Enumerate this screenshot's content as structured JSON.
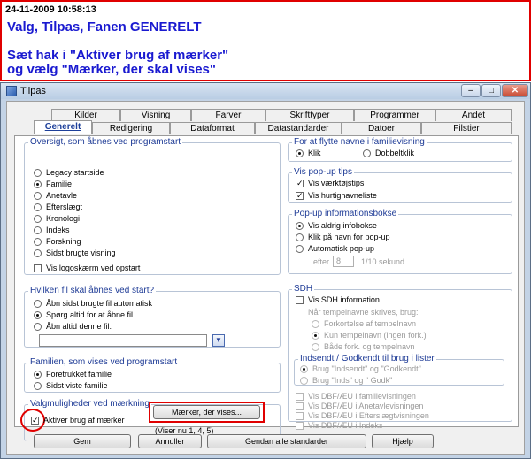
{
  "annotation": {
    "timestamp": "24-11-2009 10:58:13",
    "line1": "Valg, Tilpas, Fanen GENERELT",
    "line2": "Sæt hak i \"Aktiver brug af mærker\"",
    "line3": "og vælg \"Mærker, der skal vises\""
  },
  "window": {
    "title": "Tilpas",
    "btn_min": "–",
    "btn_max": "□",
    "btn_close": "✕"
  },
  "tabs_back": [
    "Kilder",
    "Visning",
    "Farver",
    "Skrifttyper",
    "Programmer",
    "Andet"
  ],
  "tabs_front": [
    "Generelt",
    "Redigering",
    "Dataformat",
    "Datastandarder",
    "Datoer",
    "Filstier"
  ],
  "startup": {
    "legend": "Oversigt, som åbnes ved programstart",
    "options": [
      "Legacy startside",
      "Familie",
      "Anetavle",
      "Efterslægt",
      "Kronologi",
      "Indeks",
      "Forskning",
      "Sidst brugte visning"
    ],
    "selected": "Familie",
    "logo_checkbox": "Vis logoskærm ved opstart"
  },
  "file_open": {
    "legend": "Hvilken fil skal åbnes ved start?",
    "options": [
      "Åbn sidst brugte fil automatisk",
      "Spørg altid for at åbne fil",
      "Åbn altid denne fil:"
    ],
    "selected": "Spørg altid for at åbne fil",
    "file_value": ""
  },
  "family_startup": {
    "legend": "Familien, som vises ved programstart",
    "options": [
      "Foretrukket familie",
      "Sidst viste familie"
    ],
    "selected": "Foretrukket familie"
  },
  "marking": {
    "legend": "Valgmuligheder ved mærkning",
    "checkbox": "Aktiver brug af mærker",
    "checked": true,
    "button": "Mærker, der vises...",
    "info": "(Viser nu 1, 4, 5)"
  },
  "move_names": {
    "legend": "For at flytte navne i familievisning",
    "options": [
      "Klik",
      "Dobbeltklik"
    ],
    "selected": "Klik"
  },
  "popup_tips": {
    "legend": "Vis pop-up tips",
    "items": [
      "Vis værktøjstips",
      "Vis hurtignavneliste"
    ]
  },
  "popup_info": {
    "legend": "Pop-up informationsbokse",
    "options": [
      "Vis aldrig infobokse",
      "Klik på navn for pop-up",
      "Automatisk pop-up"
    ],
    "selected": "Vis aldrig infobokse",
    "after_label": "efter",
    "after_value": "8",
    "after_unit": "1/10 sekund"
  },
  "sdh": {
    "legend": "SDH",
    "checkbox": "Vis SDH information",
    "prompt": "Når tempelnavne skrives, brug:",
    "options": [
      "Forkortelse af tempelnavn",
      "Kun tempelnavn (ingen fork.)",
      "Både fork. og tempelnavn"
    ],
    "selected": "Kun tempelnavn (ingen fork.)",
    "sub_legend": "Indsendt / Godkendt til brug i lister",
    "sub_options": [
      "Brug \"Indsendt\" og \"Godkendt\"",
      "Brug \"Inds\" og \" Godk\""
    ],
    "sub_selected": "Brug \"Indsendt\" og \"Godkendt\"",
    "dbf_items": [
      "Vis DBF/ÆU i familievisningen",
      "Vis DBF/ÆU i Anetavlevisningen",
      "Vis DBF/ÆU i Efterslægtvisningen",
      "Vis DBF/ÆU i Indeks"
    ]
  },
  "footer_buttons": [
    "Gem",
    "Annuller",
    "Gendan alle standarder",
    "Hjælp"
  ]
}
